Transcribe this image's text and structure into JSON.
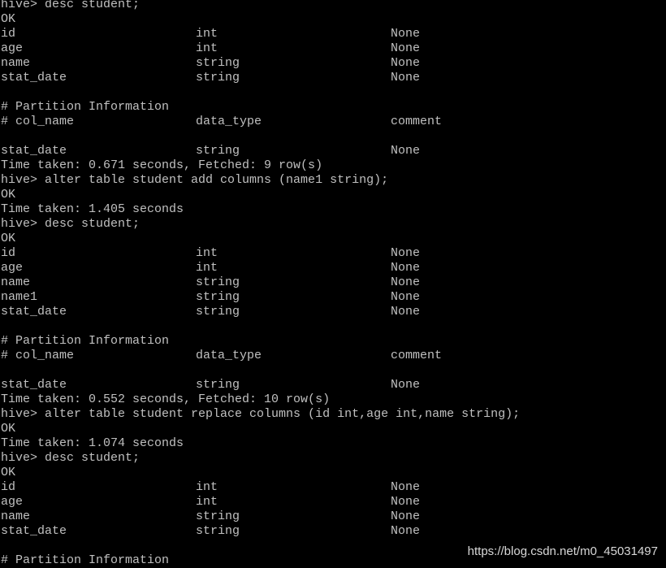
{
  "terminal": {
    "lines": [
      {
        "kind": "text",
        "text": "hive> desc student;"
      },
      {
        "kind": "text",
        "text": "OK"
      },
      {
        "kind": "row",
        "cols": [
          "id",
          "int",
          "None"
        ]
      },
      {
        "kind": "row",
        "cols": [
          "age",
          "int",
          "None"
        ]
      },
      {
        "kind": "row",
        "cols": [
          "name",
          "string",
          "None"
        ]
      },
      {
        "kind": "row",
        "cols": [
          "stat_date",
          "string",
          "None"
        ]
      },
      {
        "kind": "text",
        "text": ""
      },
      {
        "kind": "text",
        "text": "# Partition Information"
      },
      {
        "kind": "row",
        "cols": [
          "# col_name",
          "data_type",
          "comment"
        ]
      },
      {
        "kind": "text",
        "text": ""
      },
      {
        "kind": "row",
        "cols": [
          "stat_date",
          "string",
          "None"
        ]
      },
      {
        "kind": "text",
        "text": "Time taken: 0.671 seconds, Fetched: 9 row(s)"
      },
      {
        "kind": "text",
        "text": "hive> alter table student add columns (name1 string);"
      },
      {
        "kind": "text",
        "text": "OK"
      },
      {
        "kind": "text",
        "text": "Time taken: 1.405 seconds"
      },
      {
        "kind": "text",
        "text": "hive> desc student;"
      },
      {
        "kind": "text",
        "text": "OK"
      },
      {
        "kind": "row",
        "cols": [
          "id",
          "int",
          "None"
        ]
      },
      {
        "kind": "row",
        "cols": [
          "age",
          "int",
          "None"
        ]
      },
      {
        "kind": "row",
        "cols": [
          "name",
          "string",
          "None"
        ]
      },
      {
        "kind": "row",
        "cols": [
          "name1",
          "string",
          "None"
        ]
      },
      {
        "kind": "row",
        "cols": [
          "stat_date",
          "string",
          "None"
        ]
      },
      {
        "kind": "text",
        "text": ""
      },
      {
        "kind": "text",
        "text": "# Partition Information"
      },
      {
        "kind": "row",
        "cols": [
          "# col_name",
          "data_type",
          "comment"
        ]
      },
      {
        "kind": "text",
        "text": ""
      },
      {
        "kind": "row",
        "cols": [
          "stat_date",
          "string",
          "None"
        ]
      },
      {
        "kind": "text",
        "text": "Time taken: 0.552 seconds, Fetched: 10 row(s)"
      },
      {
        "kind": "text",
        "text": "hive> alter table student replace columns (id int,age int,name string);"
      },
      {
        "kind": "text",
        "text": "OK"
      },
      {
        "kind": "text",
        "text": "Time taken: 1.074 seconds"
      },
      {
        "kind": "text",
        "text": "hive> desc student;"
      },
      {
        "kind": "text",
        "text": "OK"
      },
      {
        "kind": "row",
        "cols": [
          "id",
          "int",
          "None"
        ]
      },
      {
        "kind": "row",
        "cols": [
          "age",
          "int",
          "None"
        ]
      },
      {
        "kind": "row",
        "cols": [
          "name",
          "string",
          "None"
        ]
      },
      {
        "kind": "row",
        "cols": [
          "stat_date",
          "string",
          "None"
        ]
      },
      {
        "kind": "text",
        "text": ""
      },
      {
        "kind": "text",
        "text": "# Partition Information"
      }
    ]
  },
  "watermark": "https://blog.csdn.net/m0_45031497",
  "colors": {
    "background": "#000000",
    "text": "#c0c0c0"
  }
}
